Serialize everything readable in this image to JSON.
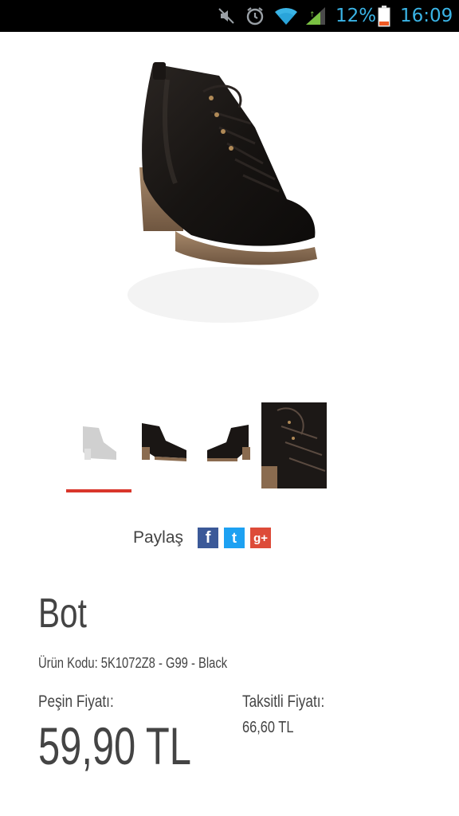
{
  "status_bar": {
    "battery_percent": "12%",
    "time": "16:09",
    "icons": [
      "mute-icon",
      "alarm-icon",
      "wifi-icon",
      "signal-icon",
      "battery-icon"
    ]
  },
  "product": {
    "title": "Bot",
    "code": "Ürün Kodu: 5K1072Z8 - G99 - Black",
    "cash_price_label": "Peşin Fiyatı:",
    "cash_price": "59,90 TL",
    "installment_label": "Taksitli Fiyatı:",
    "installment_price": "66,60 TL"
  },
  "share": {
    "label": "Paylaş",
    "facebook": "f",
    "twitter": "t",
    "googleplus": "g+"
  },
  "gallery": {
    "selected_index": 0,
    "thumbnails": [
      "thumb-1",
      "thumb-2",
      "thumb-3",
      "thumb-4"
    ]
  },
  "colors": {
    "status_text": "#3ab4e6",
    "accent_underline": "#d9362b",
    "facebook": "#3b5998",
    "twitter": "#1da1f2",
    "googleplus": "#dd4b39"
  }
}
